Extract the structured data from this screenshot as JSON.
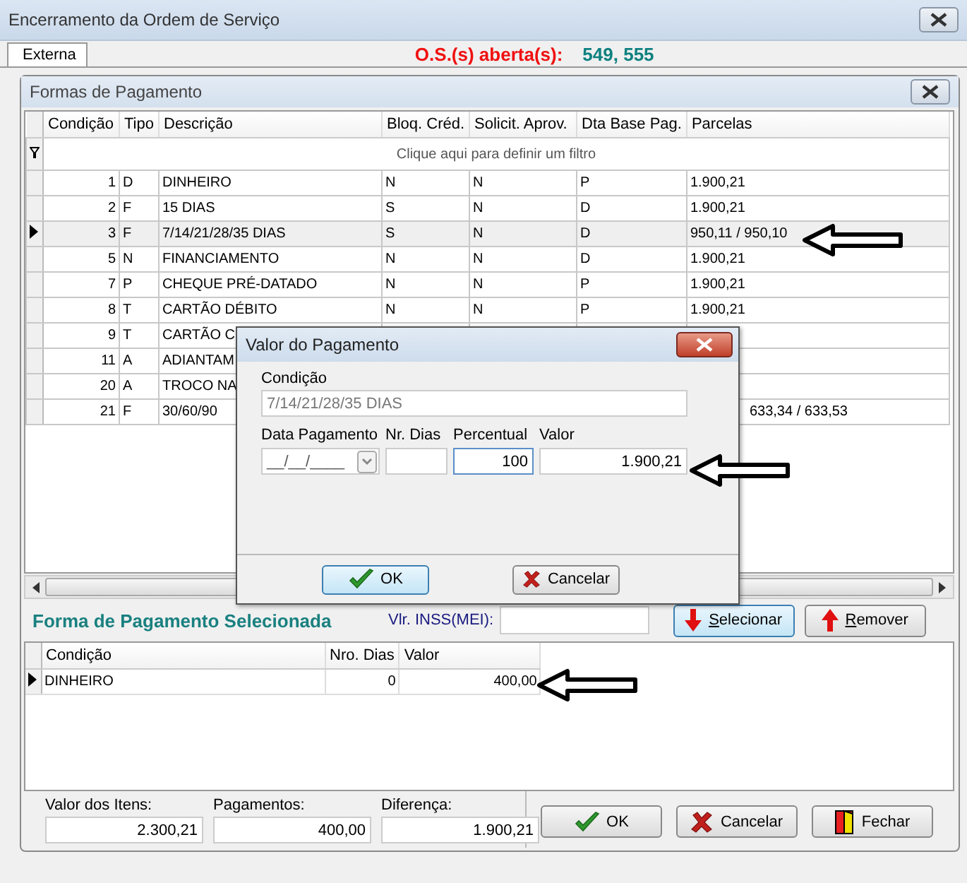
{
  "window": {
    "title": "Encerramento da Ordem de Serviço"
  },
  "tabs": [
    {
      "label": "Externa",
      "selected": true
    }
  ],
  "open_orders": {
    "label": "O.S.(s) aberta(s):",
    "value": "549, 555"
  },
  "payment_forms": {
    "title": "Formas de Pagamento",
    "columns": [
      "Condição",
      "Tipo",
      "Descrição",
      "Bloq. Créd.",
      "Solicit. Aprov.",
      "Dta Base Pag.",
      "Parcelas"
    ],
    "filter_hint": "Clique aqui para definir um filtro",
    "rows": [
      {
        "selected": false,
        "condicao": "1",
        "tipo": "D",
        "descricao": "DINHEIRO",
        "bloq_cred": "N",
        "solicit_aprov": "N",
        "dta_base_pag": "P",
        "parcelas": "1.900,21"
      },
      {
        "selected": false,
        "condicao": "2",
        "tipo": "F",
        "descricao": "15 DIAS",
        "bloq_cred": "S",
        "solicit_aprov": "N",
        "dta_base_pag": "D",
        "parcelas": "1.900,21"
      },
      {
        "selected": true,
        "condicao": "3",
        "tipo": "F",
        "descricao": "7/14/21/28/35 DIAS",
        "bloq_cred": "S",
        "solicit_aprov": "N",
        "dta_base_pag": "D",
        "parcelas": "950,11 / 950,10"
      },
      {
        "selected": false,
        "condicao": "5",
        "tipo": "N",
        "descricao": "FINANCIAMENTO",
        "bloq_cred": "N",
        "solicit_aprov": "N",
        "dta_base_pag": "D",
        "parcelas": "1.900,21"
      },
      {
        "selected": false,
        "condicao": "7",
        "tipo": "P",
        "descricao": "CHEQUE PRÉ-DATADO",
        "bloq_cred": "N",
        "solicit_aprov": "N",
        "dta_base_pag": "P",
        "parcelas": "1.900,21"
      },
      {
        "selected": false,
        "condicao": "8",
        "tipo": "T",
        "descricao": "CARTÃO DÉBITO",
        "bloq_cred": "N",
        "solicit_aprov": "N",
        "dta_base_pag": "P",
        "parcelas": "1.900,21"
      },
      {
        "selected": false,
        "condicao": "9",
        "tipo": "T",
        "descricao": "CARTÃO C"
      },
      {
        "selected": false,
        "condicao": "11",
        "tipo": "A",
        "descricao": "ADIANTAM"
      },
      {
        "selected": false,
        "condicao": "20",
        "tipo": "A",
        "descricao": "TROCO NA"
      },
      {
        "selected": false,
        "condicao": "21",
        "tipo": "F",
        "descricao": "30/60/90",
        "parcelas": "633,34 / 633,53",
        "parcelas_partly_hidden": true
      }
    ]
  },
  "selected_section": {
    "title": "Forma de Pagamento Selecionada",
    "inss_label": "Vlr. INSS(MEI):",
    "buttons": [
      {
        "label": "Selecionar",
        "kind": "select",
        "focused": true
      },
      {
        "label": "Remover",
        "kind": "remove",
        "focused": false
      }
    ],
    "columns": [
      "Condição",
      "Nro. Dias",
      "Valor"
    ],
    "rows": [
      {
        "selected": true,
        "condicao": "DINHEIRO",
        "nro_dias": "0",
        "valor": "400,00"
      }
    ]
  },
  "totals": [
    {
      "label": "Valor dos Itens:",
      "value": "2.300,21"
    },
    {
      "label": "Pagamentos:",
      "value": "400,00"
    },
    {
      "label": "Diferença:",
      "value": "1.900,21"
    }
  ],
  "buttons": [
    {
      "label": "OK",
      "kind": "confirm"
    },
    {
      "label": "Cancelar",
      "kind": "cancel"
    },
    {
      "label": "Fechar",
      "kind": "close"
    }
  ],
  "dialog": {
    "title": "Valor do Pagamento",
    "condicao_label": "Condição",
    "condicao_value": "7/14/21/28/35 DIAS",
    "fields": [
      {
        "label": "Data Pagamento",
        "kind": "date",
        "value": "__/__/____",
        "focused": false
      },
      {
        "label": "Nr. Dias",
        "kind": "text",
        "focused": false
      },
      {
        "label": "Percentual",
        "kind": "text",
        "value": "100",
        "focused": true
      },
      {
        "label": "Valor",
        "kind": "text",
        "value": "1.900,21",
        "focused": false
      }
    ],
    "buttons": [
      {
        "label": "OK",
        "kind": "confirm",
        "focused": true
      },
      {
        "label": "Cancelar",
        "kind": "cancel",
        "focused": false
      }
    ]
  }
}
